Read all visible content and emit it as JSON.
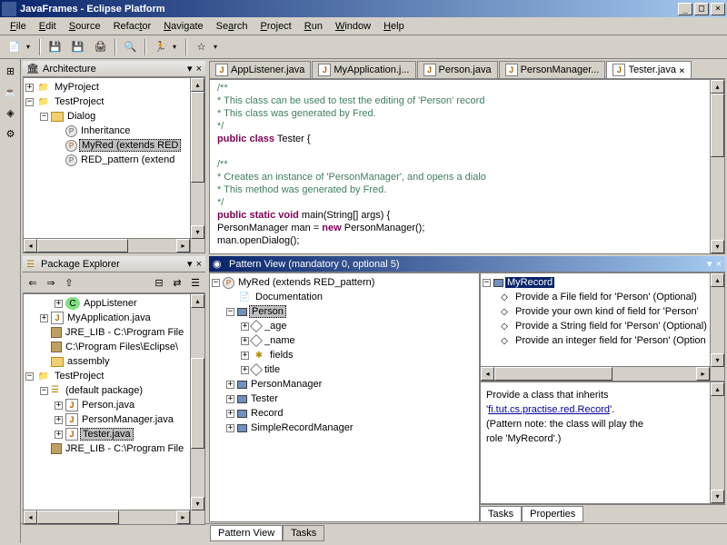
{
  "title": "JavaFrames - Eclipse Platform",
  "menus": {
    "file": "File",
    "edit": "Edit",
    "source": "Source",
    "refactor": "Refactor",
    "navigate": "Navigate",
    "search": "Search",
    "project": "Project",
    "run": "Run",
    "window": "Window",
    "help": "Help"
  },
  "panels": {
    "architecture": {
      "title": "Architecture",
      "items": [
        {
          "label": "MyProject"
        },
        {
          "label": "TestProject"
        },
        {
          "label": "Dialog"
        },
        {
          "label": "Inheritance"
        },
        {
          "label": "MyRed (extends RED"
        },
        {
          "label": "RED_pattern (extend"
        }
      ]
    },
    "package_explorer": {
      "title": "Package Explorer",
      "items": [
        {
          "label": "AppListener"
        },
        {
          "label": "MyApplication.java"
        },
        {
          "label": "JRE_LIB - C:\\Program File"
        },
        {
          "label": "C:\\Program Files\\Eclipse\\"
        },
        {
          "label": "assembly"
        },
        {
          "label": "TestProject"
        },
        {
          "label": "(default package)"
        },
        {
          "label": "Person.java"
        },
        {
          "label": "PersonManager.java"
        },
        {
          "label": "Tester.java"
        },
        {
          "label": "JRE_LIB - C:\\Program File"
        }
      ]
    },
    "pattern_view": {
      "title": "Pattern View (mandatory 0, optional 5)",
      "left_items": [
        {
          "label": "MyRed (extends RED_pattern)"
        },
        {
          "label": "Documentation"
        },
        {
          "label": "Person"
        },
        {
          "label": "_age"
        },
        {
          "label": "_name"
        },
        {
          "label": "fields"
        },
        {
          "label": "title"
        },
        {
          "label": "PersonManager"
        },
        {
          "label": "Tester"
        },
        {
          "label": "Record"
        },
        {
          "label": "SimpleRecordManager"
        }
      ],
      "right_items": [
        {
          "label": "MyRecord"
        },
        {
          "label": "Provide a File field for 'Person' (Optional)"
        },
        {
          "label": "Provide your own kind of field for 'Person'"
        },
        {
          "label": "Provide a String field for 'Person' (Optional)"
        },
        {
          "label": "Provide an integer field for 'Person' (Option"
        }
      ],
      "description": {
        "line1": "Provide a class that inherits",
        "line2_a": "'",
        "line2_link": "fi.tut.cs.practise.red.Record",
        "line2_b": "'.",
        "line3": "(Pattern note: the class will play the",
        "line4": "role 'MyRecord'.)"
      },
      "bottom_tabs": {
        "tasks": "Tasks",
        "properties": "Properties"
      }
    }
  },
  "editor": {
    "tabs": [
      {
        "label": "AppListener.java"
      },
      {
        "label": "MyApplication.j..."
      },
      {
        "label": "Person.java"
      },
      {
        "label": "PersonManager..."
      },
      {
        "label": "Tester.java"
      }
    ],
    "code": {
      "c1": "/**",
      "c2": " * This class can be used to test the editing of 'Person' record",
      "c3": " * This class was generated by Fred.",
      "c4": " */",
      "k_public": "public ",
      "k_class": "class",
      "class_name": " Tester {",
      "c5": "    /**",
      "c6": "     * Creates an instance of 'PersonManager', and opens a dialo",
      "c7": "     * This method was generated by Fred.",
      "c8": "     */",
      "k_public2": "    public ",
      "k_static": "static ",
      "k_void": "void",
      "main_sig": " main(String[] args) {",
      "line_a": "        PersonManager man = ",
      "k_new": "new",
      "line_a2": " PersonManager();",
      "line_b": "        man.openDialog();"
    }
  },
  "bottom_tabs": {
    "pattern_view": "Pattern View",
    "tasks": "Tasks"
  }
}
